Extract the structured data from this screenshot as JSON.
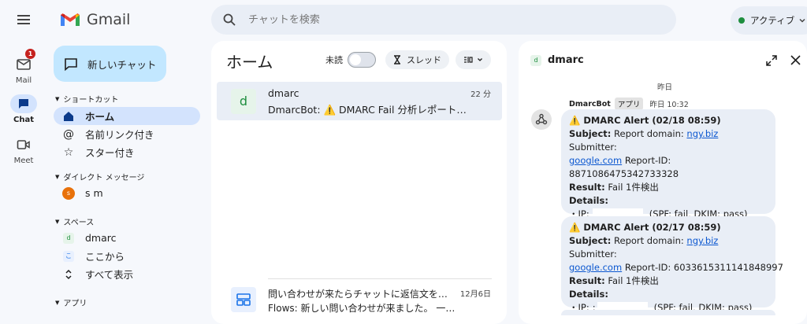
{
  "app": {
    "name": "Gmail"
  },
  "search": {
    "placeholder": "チャットを検索"
  },
  "status": {
    "label": "アクティブ",
    "color": "#1e8e3e"
  },
  "rail": [
    {
      "label": "Mail",
      "badge": "1"
    },
    {
      "label": "Chat"
    },
    {
      "label": "Meet"
    }
  ],
  "new_chat": {
    "label": "新しいチャット"
  },
  "nav": {
    "shortcuts_header": "ショートカット",
    "home": "ホーム",
    "mentions": "名前リンク付き",
    "starred": "スター付き",
    "dm_header": "ダイレクト メッセージ",
    "dm_user": "s m",
    "dm_avatar": "s",
    "spaces_header": "スペース",
    "space1": "dmarc",
    "space1_icon": "d",
    "space2": "ここから",
    "space2_icon": "こ",
    "show_all": "すべて表示",
    "apps_header": "アプリ"
  },
  "home_panel": {
    "title": "ホーム",
    "unread_label": "未読",
    "thread_label": "スレッド",
    "items": [
      {
        "name": "dmarc",
        "icon": "d",
        "preview": "DmarcBot: ⚠️ DMARC Fail 分析レポート…",
        "time": "22 分"
      },
      {
        "name": "問い合わせが来たらチャットに返信文を…",
        "preview": "Flows: 新しい問い合わせが来ました。 一…",
        "time": "12月6日"
      }
    ]
  },
  "chat_panel": {
    "title": "dmarc",
    "title_icon": "d",
    "date_divider": "昨日",
    "sender": "DmarcBot",
    "sender_tag": "アプリ",
    "sent_time": "昨日 10:32",
    "messages": [
      {
        "title": "⚠️ DMARC Alert (02/18 08:59)",
        "subject_label": "Subject:",
        "subject_text": "Report domain:",
        "domain": "ngy.biz",
        "submitter_label": "Submitter:",
        "submitter": "google.com",
        "report_id_label": "Report-ID:",
        "report_id": "8871086475342733328",
        "result_label": "Result:",
        "result": "Fail 1件検出",
        "details_label": "Details:",
        "ip_prefix": "・IP:",
        "ip_result": "(SPF: fail, DKIM: pass)"
      },
      {
        "title": "⚠️ DMARC Alert (02/17 08:59)",
        "subject_label": "Subject:",
        "subject_text": "Report domain:",
        "domain": "ngy.biz",
        "submitter_label": "Submitter:",
        "submitter": "google.com",
        "report_id_label": "Report-ID:",
        "report_id": "6033615311141848997",
        "result_label": "Result:",
        "result": "Fail 1件検出",
        "details_label": "Details:",
        "ip_prefix": "・IP:",
        "ip_prefix_tail": ":",
        "ip_result": "(SPF: fail, DKIM: pass)"
      }
    ]
  }
}
